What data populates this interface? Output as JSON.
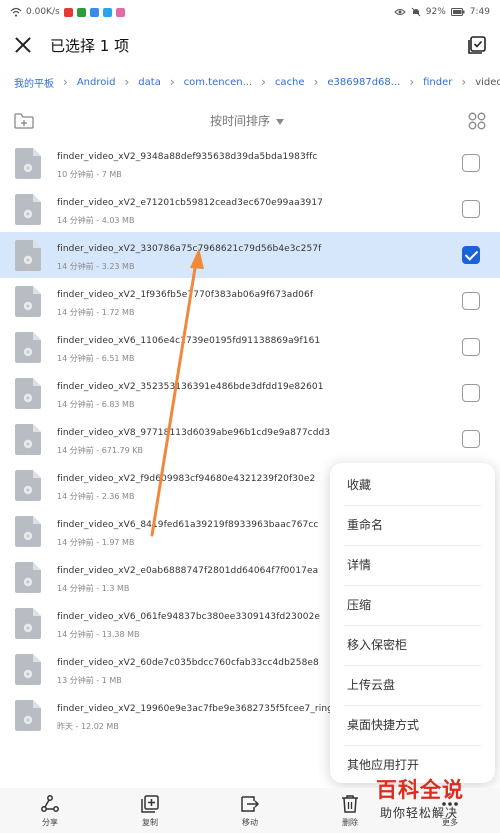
{
  "status_bar": {
    "speed": "0.00K/s",
    "battery": "92%",
    "time": "7:49",
    "app_colors": [
      "#e53935",
      "#2e9b3c",
      "#3b8be8",
      "#2aa3e8",
      "#e26ba5"
    ]
  },
  "header": {
    "title": "已选择 1 项"
  },
  "breadcrumb": [
    "我的平板",
    "Android",
    "data",
    "com.tencen...",
    "cache",
    "e386987d68...",
    "finder",
    "video"
  ],
  "toolbar": {
    "sort_label": "按时间排序"
  },
  "files": [
    {
      "name": "finder_video_xV2_9348a88def935638d39da5bda1983ffc",
      "meta": "10 分钟前 - 7 MB",
      "selected": false
    },
    {
      "name": "finder_video_xV2_e71201cb59812cead3ec670e99aa3917",
      "meta": "14 分钟前 - 4.03 MB",
      "selected": false
    },
    {
      "name": "finder_video_xV2_330786a75c7968621c79d56b4e3c257f",
      "meta": "14 分钟前 - 3.23 MB",
      "selected": true
    },
    {
      "name": "finder_video_xV2_1f936fb5e7770f383ab06a9f673ad06f",
      "meta": "14 分钟前 - 1.72 MB",
      "selected": false
    },
    {
      "name": "finder_video_xV6_1106e4c1739e0195fd91138869a9f161",
      "meta": "14 分钟前 - 6.51 MB",
      "selected": false
    },
    {
      "name": "finder_video_xV2_352353136391e486bde3dfdd19e82601",
      "meta": "14 分钟前 - 6.83 MB",
      "selected": false
    },
    {
      "name": "finder_video_xV8_97718113d6039abe96b1cd9e9a877cdd3",
      "meta": "14 分钟前 - 671.79 KB",
      "selected": false
    },
    {
      "name": "finder_video_xV2_f9d609983cf94680e4321239f20f30e2",
      "meta": "14 分钟前 - 2.36 MB",
      "selected": false
    },
    {
      "name": "finder_video_xV6_8419fed61a39219f8933963baac767cc",
      "meta": "14 分钟前 - 1.97 MB",
      "selected": false
    },
    {
      "name": "finder_video_xV2_e0ab6888747f2801dd64064f7f0017ea",
      "meta": "14 分钟前 - 1.3 MB",
      "selected": false
    },
    {
      "name": "finder_video_xV6_061fe94837bc380ee3309143fd23002e",
      "meta": "14 分钟前 - 13.38 MB",
      "selected": false
    },
    {
      "name": "finder_video_xV2_60de7c035bdcc760cfab33cc4db258e8",
      "meta": "13 分钟前 - 1 MB",
      "selected": false
    },
    {
      "name": "finder_video_xV2_19960e9e3ac7fbe9e3682735f5fcee7_ring",
      "meta": "昨天 - 12.02 MB",
      "selected": false
    }
  ],
  "context_menu": [
    "收藏",
    "重命名",
    "详情",
    "压缩",
    "移入保密柜",
    "上传云盘",
    "桌面快捷方式",
    "其他应用打开"
  ],
  "bottom_actions": [
    {
      "label": "分享",
      "icon": "share-icon"
    },
    {
      "label": "复制",
      "icon": "copy-icon"
    },
    {
      "label": "移动",
      "icon": "move-icon"
    },
    {
      "label": "删除",
      "icon": "delete-icon"
    },
    {
      "label": "更多",
      "icon": "more-icon"
    }
  ],
  "watermark": {
    "main": "百科全说",
    "sub": "助你轻松解决"
  },
  "colors": {
    "accent": "#1a62d6",
    "selected_row": "#d6e7fb",
    "annotation_arrow": "#f08a3a",
    "watermark_red": "#d92d21"
  }
}
